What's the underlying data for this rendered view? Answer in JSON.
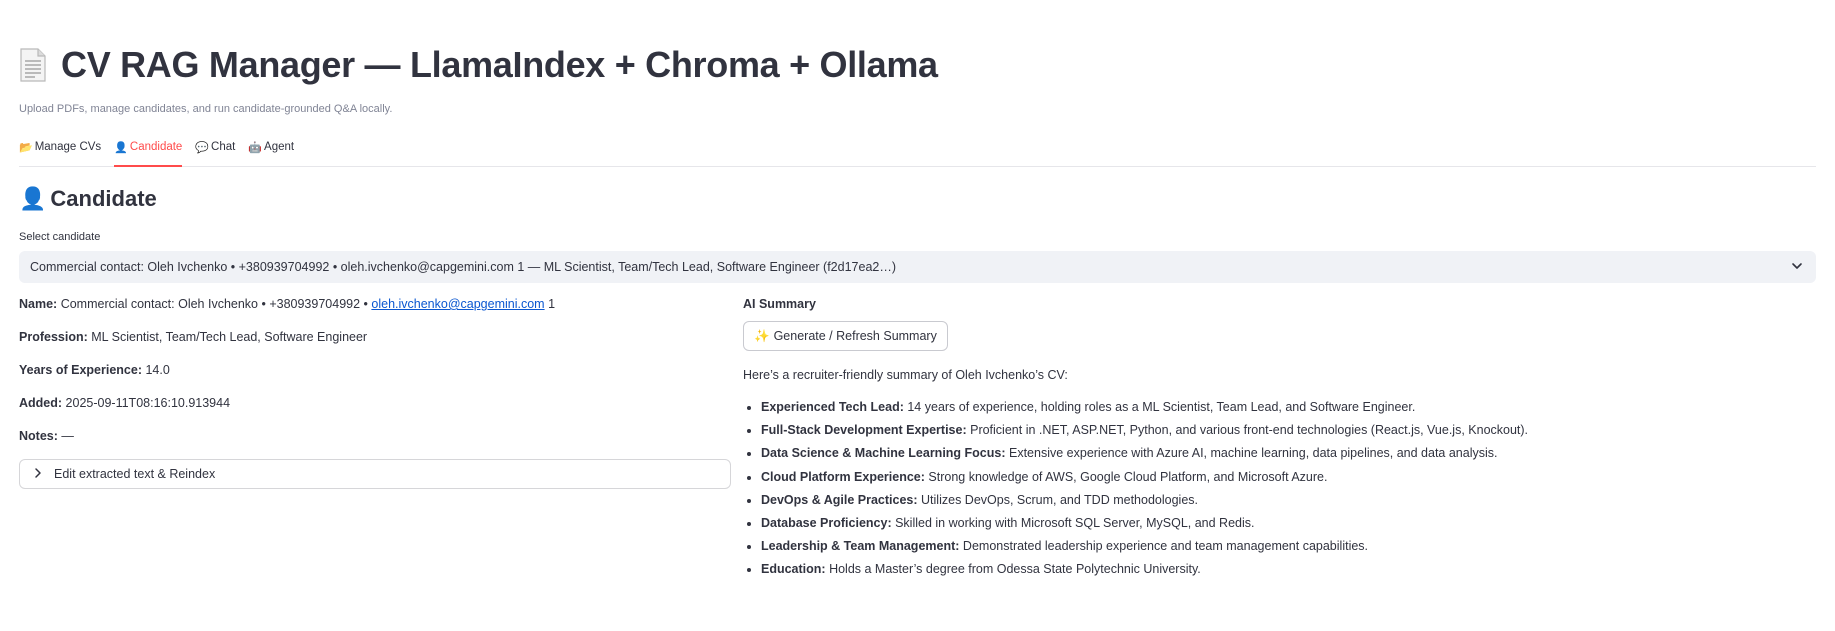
{
  "app": {
    "title": "CV RAG Manager — LlamaIndex + Chroma + Ollama",
    "subtitle": "Upload PDFs, manage candidates, and run candidate-grounded Q&A locally."
  },
  "tabs": [
    {
      "label": "Manage CVs",
      "icon": "folder-icon",
      "active": false
    },
    {
      "label": "Candidate",
      "icon": "person-icon",
      "active": true
    },
    {
      "label": "Chat",
      "icon": "speech-bubble-icon",
      "active": false
    },
    {
      "label": "Agent",
      "icon": "robot-icon",
      "active": false
    }
  ],
  "section": {
    "heading": "Candidate"
  },
  "select": {
    "label": "Select candidate",
    "value": "Commercial contact: Oleh Ivchenko • +380939704992 • oleh.ivchenko@capgemini.com 1 — ML Scientist, Team/Tech Lead, Software Engineer (f2d17ea2…)"
  },
  "candidate": {
    "name_label": "Name:",
    "name_prefix": "Commercial contact: Oleh Ivchenko • +380939704992 •",
    "email": "oleh.ivchenko@capgemini.com",
    "name_suffix": "1",
    "profession_label": "Profession:",
    "profession": "ML Scientist, Team/Tech Lead, Software Engineer",
    "years_label": "Years of Experience:",
    "years": "14.0",
    "added_label": "Added:",
    "added": "2025-09-11T08:16:10.913944",
    "notes_label": "Notes:",
    "notes": "—"
  },
  "expander": {
    "label": "Edit extracted text & Reindex"
  },
  "summary": {
    "label": "AI Summary",
    "button": "Generate / Refresh Summary",
    "intro": "Here’s a recruiter-friendly summary of Oleh Ivchenko’s CV:",
    "items": [
      {
        "title": "Experienced Tech Lead:",
        "text": "14 years of experience, holding roles as a ML Scientist, Team Lead, and Software Engineer."
      },
      {
        "title": "Full-Stack Development Expertise:",
        "text": "Proficient in .NET, ASP.NET, Python, and various front-end technologies (React.js, Vue.js, Knockout)."
      },
      {
        "title": "Data Science & Machine Learning Focus:",
        "text": "Extensive experience with Azure AI, machine learning, data pipelines, and data analysis."
      },
      {
        "title": "Cloud Platform Experience:",
        "text": "Strong knowledge of AWS, Google Cloud Platform, and Microsoft Azure."
      },
      {
        "title": "DevOps & Agile Practices:",
        "text": "Utilizes DevOps, Scrum, and TDD methodologies."
      },
      {
        "title": "Database Proficiency:",
        "text": "Skilled in working with Microsoft SQL Server, MySQL, and Redis."
      },
      {
        "title": "Leadership & Team Management:",
        "text": "Demonstrated leadership experience and team management capabilities."
      },
      {
        "title": "Education:",
        "text": "Holds a Master’s degree from Odessa State Polytechnic University."
      }
    ]
  },
  "colors": {
    "accent": "#ff4b4b",
    "text": "#31333f",
    "muted": "#808495",
    "select_bg": "#f0f2f6",
    "link": "#0b57d0"
  }
}
